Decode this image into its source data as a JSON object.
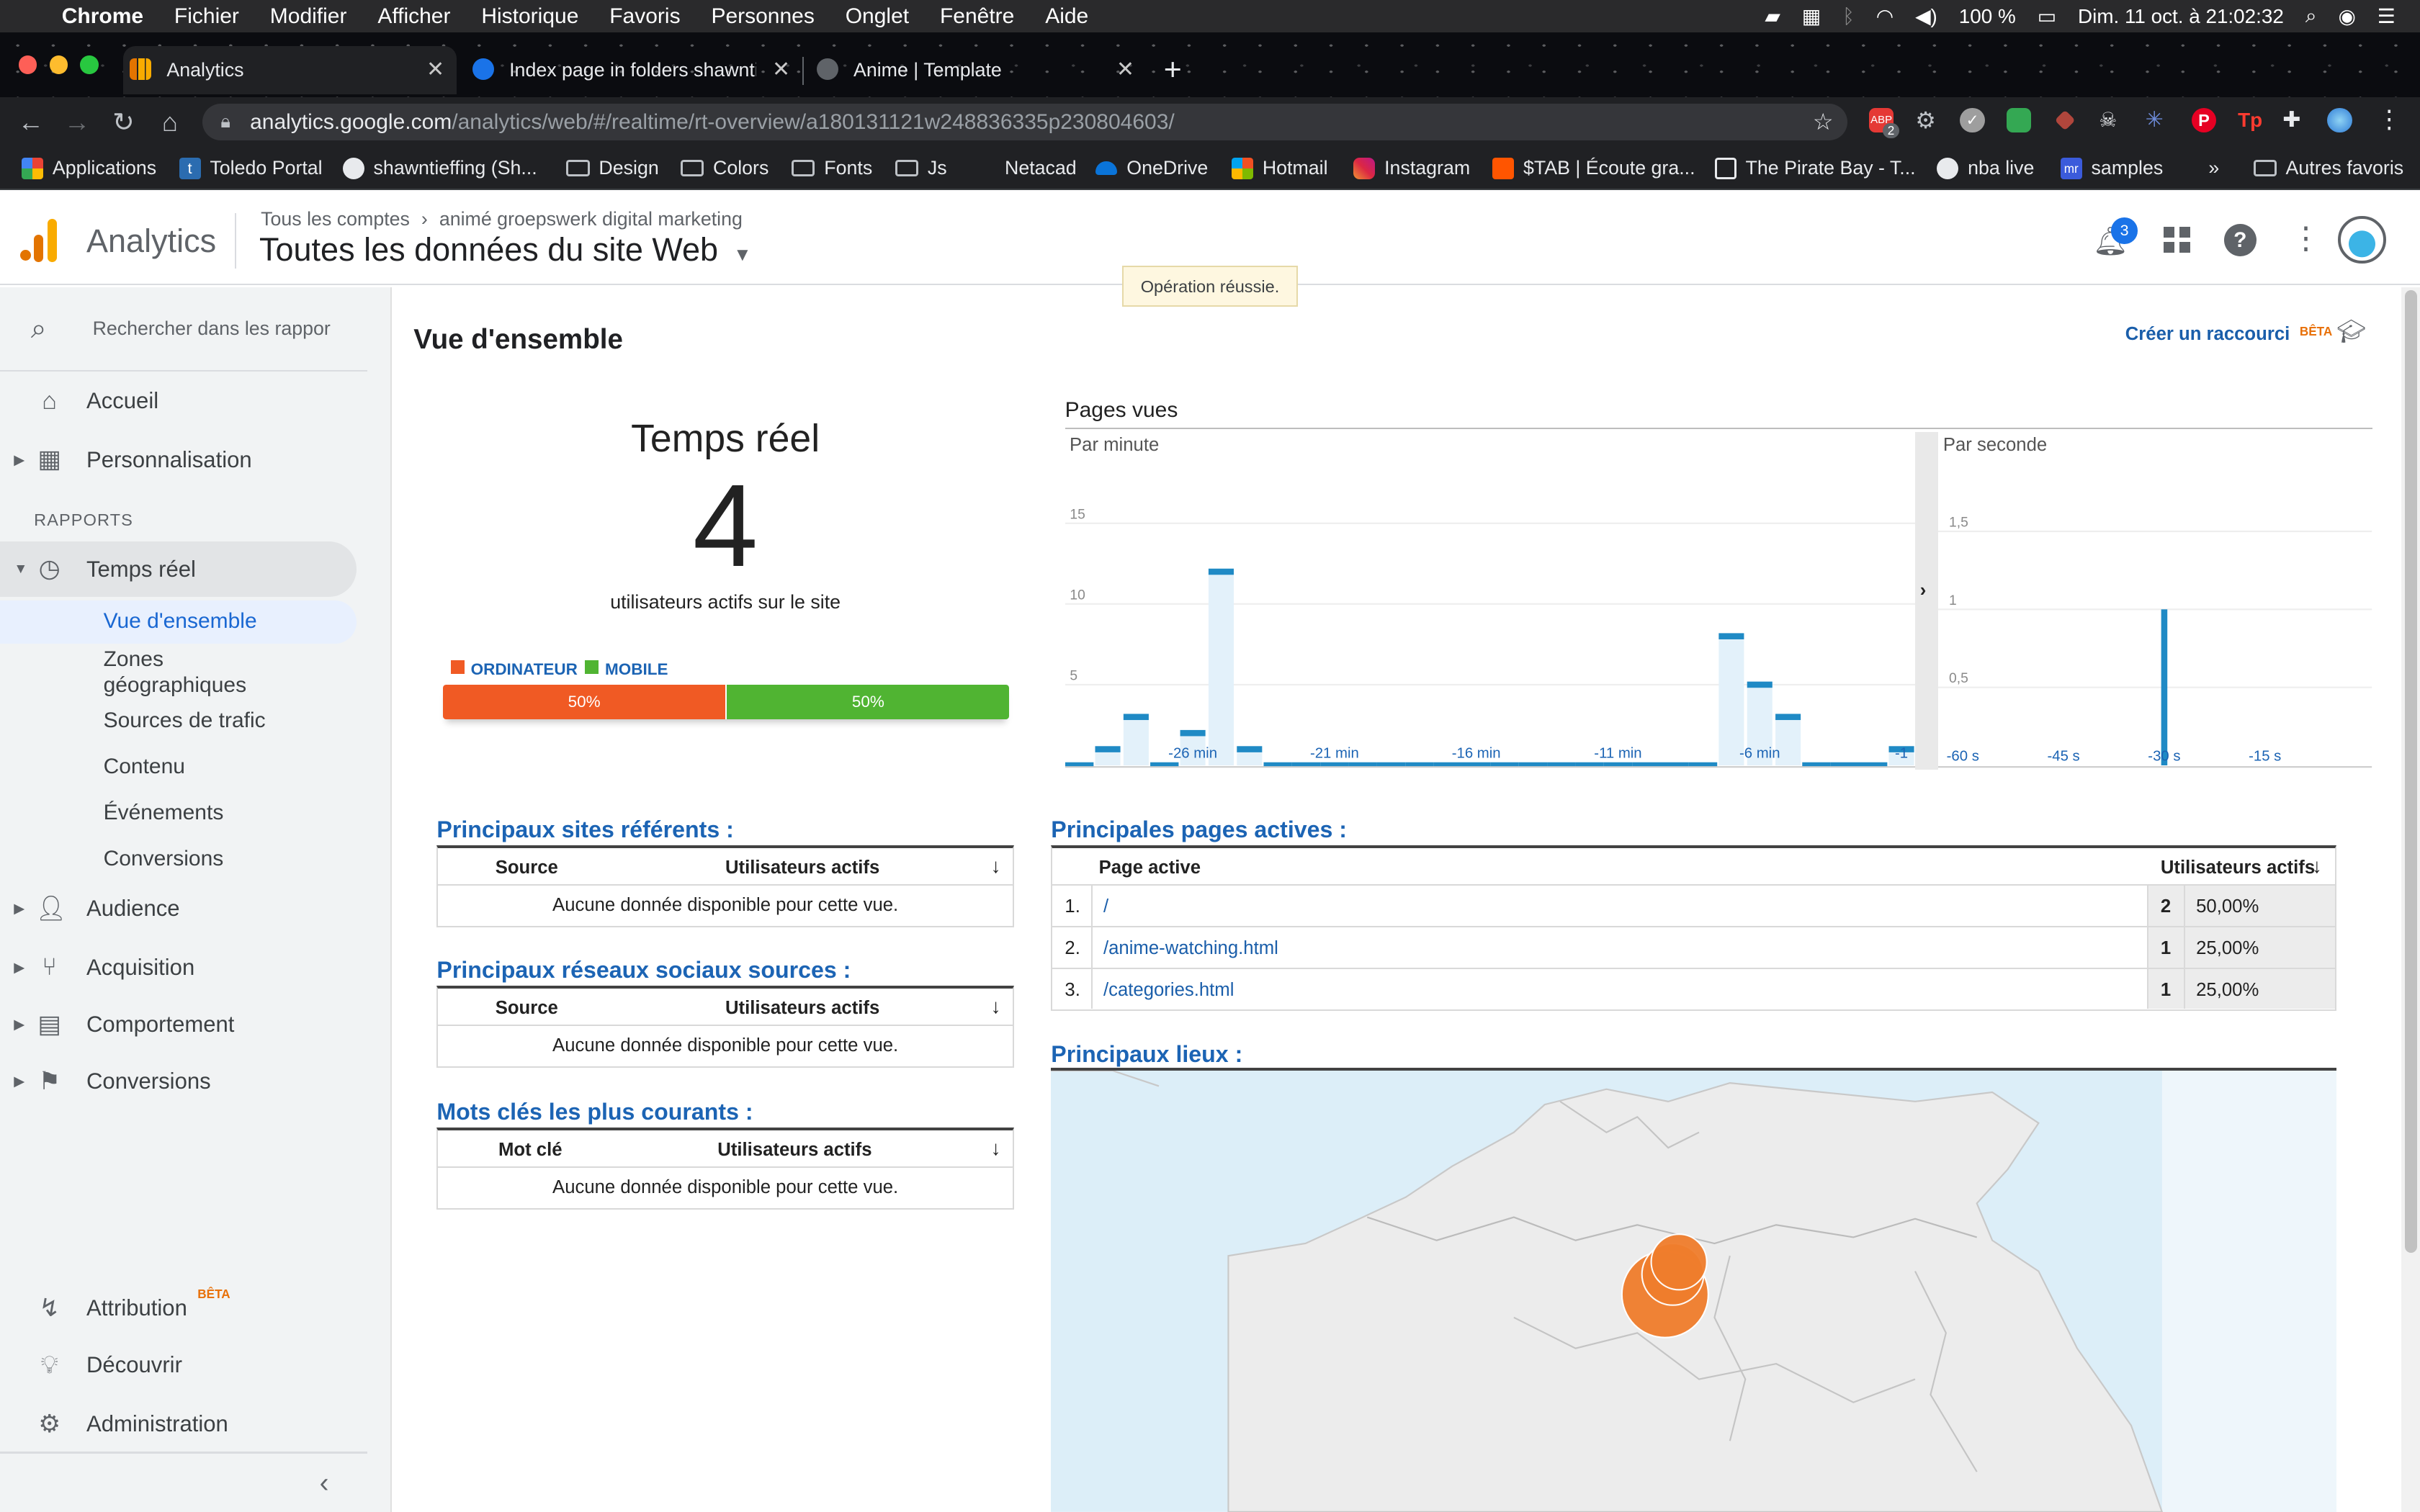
{
  "os_menubar": {
    "app": "Chrome",
    "items": [
      "Fichier",
      "Modifier",
      "Afficher",
      "Historique",
      "Favoris",
      "Personnes",
      "Onglet",
      "Fenêtre",
      "Aide"
    ],
    "battery": "100 %",
    "datetime": "Dim. 11 oct. à 21:02:32"
  },
  "browser": {
    "tabs": [
      {
        "title": "Analytics"
      },
      {
        "title": "Index page in folders shawntie"
      },
      {
        "title": "Anime | Template"
      }
    ],
    "url_host": "analytics.google.com",
    "url_path": "/analytics/web/#/realtime/rt-overview/a180131121w248836335p230804603/",
    "bookmarks": [
      "Applications",
      "Toledo Portal",
      "shawntieffing (Sh...",
      "Design",
      "Colors",
      "Fonts",
      "Js",
      "Netacad",
      "OneDrive",
      "Hotmail",
      "Instagram",
      "$TAB | Écoute gra...",
      "The Pirate Bay - T...",
      "nba live",
      "samples",
      "»",
      "Autres favoris"
    ],
    "ext_badge": "2"
  },
  "ga_header": {
    "product": "Analytics",
    "breadcrumb_account": "Tous les comptes",
    "breadcrumb_property": "animé groepswerk digital marketing",
    "view_title": "Toutes les données du site Web",
    "notification_count": "3",
    "toast": "Opération réussie."
  },
  "sidebar": {
    "search_placeholder": "Rechercher dans les rappor",
    "home": "Accueil",
    "customization": "Personnalisation",
    "reports_heading": "RAPPORTS",
    "realtime": "Temps réel",
    "realtime_sub": [
      "Vue d'ensemble",
      "Zones géographiques",
      "Sources de trafic",
      "Contenu",
      "Événements",
      "Conversions"
    ],
    "audience": "Audience",
    "acquisition": "Acquisition",
    "behavior": "Comportement",
    "conversions": "Conversions",
    "attribution": "Attribution",
    "beta": "BÊTA",
    "discover": "Découvrir",
    "admin": "Administration"
  },
  "overview": {
    "title": "Vue d'ensemble",
    "shortcut": "Créer un raccourci",
    "shortcut_badge": "BÊTA",
    "realtime_title": "Temps réel",
    "active_users": "4",
    "active_users_label": "utilisateurs actifs sur le site",
    "device_legend": [
      "ORDINATEUR",
      "MOBILE"
    ],
    "device_split": [
      0.5,
      0.5
    ],
    "device_labels": [
      "50%",
      "50%"
    ],
    "colors": {
      "desktop": "#f05a24",
      "mobile": "#50b432",
      "link": "#1c64b4",
      "bar": "#1f8ac5"
    }
  },
  "chart_data": [
    {
      "type": "bar",
      "title": "Pages vues",
      "subtitle": "Par minute",
      "x": [
        -30,
        -29,
        -28,
        -27,
        -26,
        -25,
        -24,
        -23,
        -22,
        -21,
        -20,
        -19,
        -18,
        -17,
        -16,
        -15,
        -14,
        -13,
        -12,
        -11,
        -10,
        -9,
        -8,
        -7,
        -6,
        -5,
        -4,
        -3,
        -2,
        -1
      ],
      "values": [
        0,
        1,
        3,
        0,
        2,
        12,
        1,
        0,
        0,
        0,
        0,
        0,
        0,
        0,
        0,
        0,
        0,
        0,
        0,
        0,
        0,
        0,
        0,
        8,
        5,
        3,
        0,
        0,
        0,
        1
      ],
      "xticks": [
        "-26 min",
        "-21 min",
        "-16 min",
        "-11 min",
        "-6 min",
        "-1"
      ],
      "yticks": [
        "5",
        "10",
        "15"
      ],
      "ylim": [
        0,
        15
      ]
    },
    {
      "type": "bar",
      "subtitle": "Par seconde",
      "x": [
        -30
      ],
      "values": [
        1
      ],
      "xticks": [
        "-60 s",
        "-45 s",
        "-30 s",
        "-15 s"
      ],
      "yticks": [
        "0,5",
        "1",
        "1,5"
      ],
      "ylim": [
        0,
        1.5
      ]
    }
  ],
  "referrers": {
    "title": "Principaux sites référents :",
    "col_source": "Source",
    "col_users": "Utilisateurs actifs",
    "empty": "Aucune donnée disponible pour cette vue."
  },
  "social": {
    "title": "Principaux réseaux sociaux sources :",
    "col_source": "Source",
    "col_users": "Utilisateurs actifs",
    "empty": "Aucune donnée disponible pour cette vue."
  },
  "keywords": {
    "title": "Mots clés les plus courants :",
    "col_keyword": "Mot clé",
    "col_users": "Utilisateurs actifs",
    "empty": "Aucune donnée disponible pour cette vue."
  },
  "active_pages": {
    "title": "Principales pages actives :",
    "col_page": "Page active",
    "col_users": "Utilisateurs actifs",
    "rows": [
      {
        "rank": "1.",
        "page": "/",
        "users": "2",
        "pct": "50,00%"
      },
      {
        "rank": "2.",
        "page": "/anime-watching.html",
        "users": "1",
        "pct": "25,00%"
      },
      {
        "rank": "3.",
        "page": "/categories.html",
        "users": "1",
        "pct": "25,00%"
      }
    ]
  },
  "locations": {
    "title": "Principaux lieux :"
  }
}
